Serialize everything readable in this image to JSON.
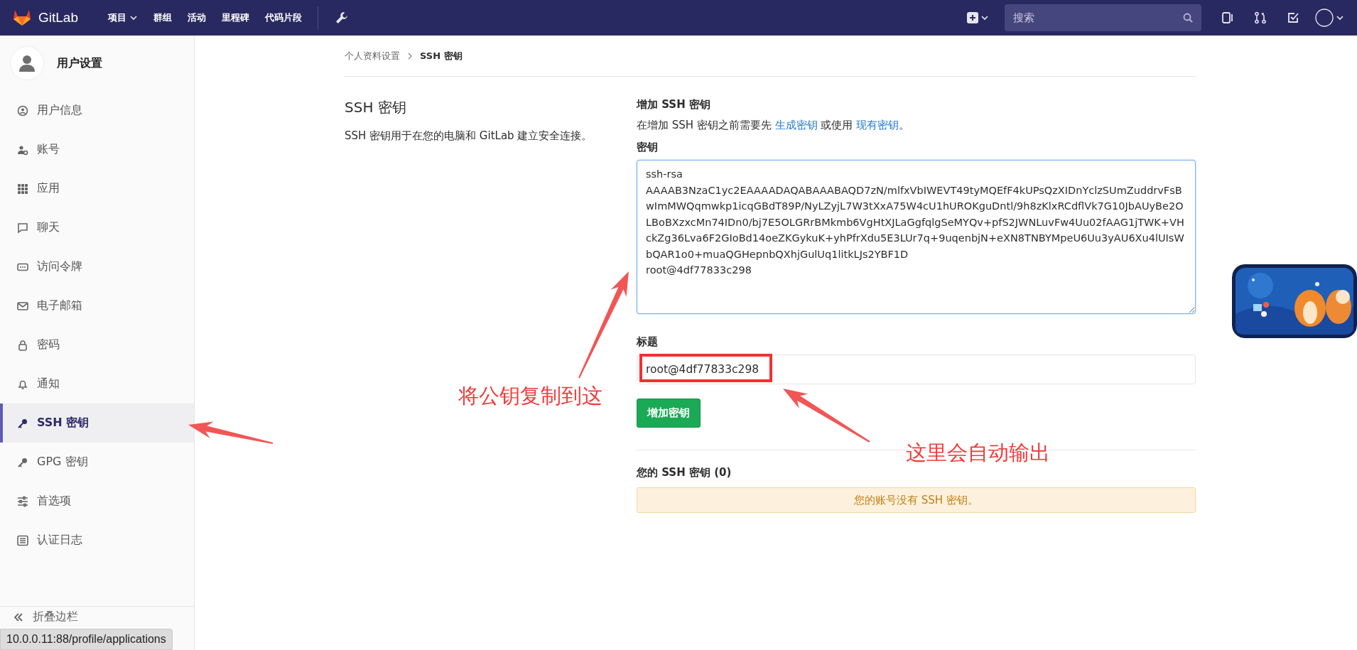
{
  "topbar": {
    "logo": "GitLab",
    "nav": [
      {
        "label": "项目",
        "dropdown": true
      },
      {
        "label": "群组",
        "dropdown": false
      },
      {
        "label": "活动",
        "dropdown": false
      },
      {
        "label": "里程碑",
        "dropdown": false
      },
      {
        "label": "代码片段",
        "dropdown": false
      }
    ],
    "search": {
      "placeholder": "搜索"
    }
  },
  "sidebar": {
    "title": "用户设置",
    "items": [
      {
        "label": "用户信息",
        "selected": false
      },
      {
        "label": "账号",
        "selected": false
      },
      {
        "label": "应用",
        "selected": false
      },
      {
        "label": "聊天",
        "selected": false
      },
      {
        "label": "访问令牌",
        "selected": false
      },
      {
        "label": "电子邮箱",
        "selected": false
      },
      {
        "label": "密码",
        "selected": false
      },
      {
        "label": "通知",
        "selected": false
      },
      {
        "label": "SSH 密钥",
        "selected": true
      },
      {
        "label": "GPG 密钥",
        "selected": false
      },
      {
        "label": "首选项",
        "selected": false
      },
      {
        "label": "认证日志",
        "selected": false
      }
    ],
    "collapse": "折叠边栏"
  },
  "breadcrumb": [
    {
      "label": "个人资料设置",
      "current": false
    },
    {
      "label": "SSH 密钥",
      "current": true
    }
  ],
  "intro": {
    "title": "SSH 密钥",
    "description": "SSH 密钥用于在您的电脑和 GitLab 建立安全连接。"
  },
  "form": {
    "heading": "增加 SSH 密钥",
    "hint": [
      {
        "kind": "text",
        "text": "在增加 SSH 密钥之前需要先 "
      },
      {
        "kind": "link",
        "text": "生成密钥"
      },
      {
        "kind": "text",
        "text": " 或使用 "
      },
      {
        "kind": "link",
        "text": "现有密钥"
      },
      {
        "kind": "text",
        "text": "。"
      }
    ],
    "key_label": "密钥",
    "key_value": "ssh-rsa\nAAAAB3NzaC1yc2EAAAADAQABAAABAQD7zN/mlfxVbIWEVT49tyMQEfF4kUPsQzXIDnYclzSUmZuddrvFsBwImMWQqmwkp1icqGBdT89P/NyLZyjL7W3tXxA75W4cU1hUROKguDntl/9h8zKlxRCdflVk7G10JbAUyBe2OLBoBXzxcMn74IDn0/bj7E5OLGRrBMkmb6VgHtXJLaGgfqlgSeMYQv+pfS2JWNLuvFw4Uu02fAAG1jTWK+VHckZg36Lva6F2GIoBd14oeZKGykuK+yhPfrXdu5E3LUr7q+9uqenbjN+eXN8TNBYMpeU6Uu3yAU6Xu4lUIsWbQAR1o0+muaQGHepnbQXhjGulUq1litkLJs2YBF1D\nroot@4df77833c298",
    "title_label": "标题",
    "title_value": "root@4df77833c298",
    "submit": "增加密钥"
  },
  "keys": {
    "heading": "您的 SSH 密钥 (0)",
    "empty": "您的账号没有 SSH 密钥。"
  },
  "annotations": [
    {
      "text": "将公钥复制到这"
    },
    {
      "text": "这里会自动输出"
    }
  ],
  "status_url": "10.0.0.11:88/profile/applications"
}
